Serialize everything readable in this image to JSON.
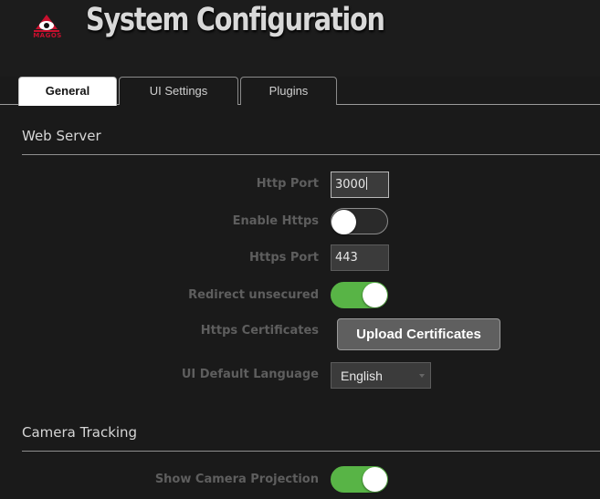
{
  "header": {
    "logo_text": "MAGOS",
    "title": "System Configuration"
  },
  "tabs": [
    {
      "label": "General",
      "active": true
    },
    {
      "label": "UI Settings",
      "active": false
    },
    {
      "label": "Plugins",
      "active": false
    }
  ],
  "web_server": {
    "title": "Web Server",
    "http_port": {
      "label": "Http Port",
      "value": "3000"
    },
    "enable_https": {
      "label": "Enable Https",
      "on": false
    },
    "https_port": {
      "label": "Https Port",
      "value": "443"
    },
    "redirect_unsecured": {
      "label": "Redirect unsecured",
      "on": true
    },
    "https_certificates": {
      "label": "Https Certificates",
      "button": "Upload Certificates"
    },
    "ui_default_language": {
      "label": "UI Default Language",
      "value": "English"
    }
  },
  "camera_tracking": {
    "title": "Camera Tracking",
    "show_camera_projection": {
      "label": "Show Camera Projection",
      "on": true
    }
  },
  "colors": {
    "toggle_on": "#58b446",
    "logo_red": "#c8102e",
    "background": "#1a1a1a"
  }
}
